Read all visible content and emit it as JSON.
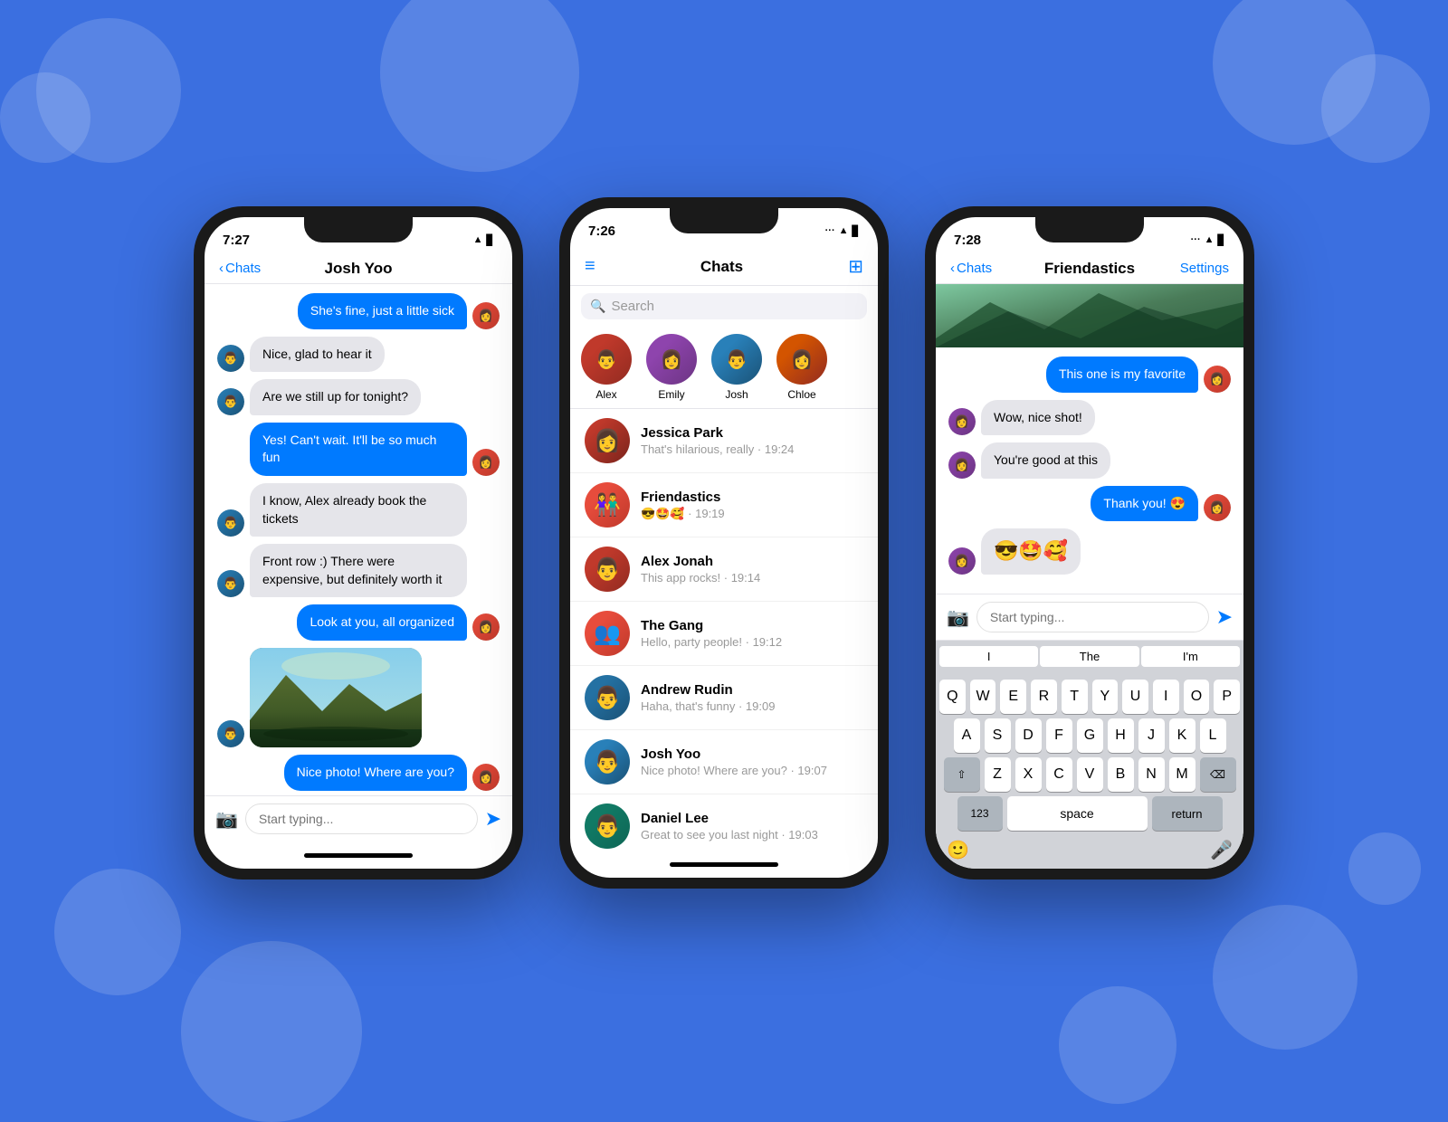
{
  "background": "#3B6FE0",
  "phone1": {
    "time": "7:27",
    "back_label": "Chats",
    "contact_name": "Josh Yoo",
    "messages": [
      {
        "id": 1,
        "type": "sent",
        "text": "She's fine, just a little sick",
        "has_avatar": true
      },
      {
        "id": 2,
        "type": "received",
        "text": "Nice, glad to hear it",
        "has_avatar": true
      },
      {
        "id": 3,
        "type": "received",
        "text": "Are we still up for tonight?",
        "has_avatar": true
      },
      {
        "id": 4,
        "type": "sent",
        "text": "Yes! Can't wait. It'll be so much fun",
        "has_avatar": true
      },
      {
        "id": 5,
        "type": "received",
        "text": "I know, Alex already book the tickets",
        "has_avatar": true
      },
      {
        "id": 6,
        "type": "received",
        "text": "Front row :) There were expensive, but definitely worth it",
        "has_avatar": true
      },
      {
        "id": 7,
        "type": "sent",
        "text": "Look at you, all organized",
        "has_avatar": true
      },
      {
        "id": 8,
        "type": "received",
        "text": "image",
        "is_image": true,
        "has_avatar": true
      },
      {
        "id": 9,
        "type": "sent",
        "text": "Nice photo! Where are you?",
        "has_avatar": true
      }
    ],
    "input_placeholder": "Start typing..."
  },
  "phone2": {
    "time": "7:26",
    "title": "Chats",
    "search_placeholder": "Search",
    "active_users": [
      {
        "name": "Alex",
        "avatar": "alex"
      },
      {
        "name": "Emily",
        "avatar": "emily"
      },
      {
        "name": "Josh",
        "avatar": "josh"
      },
      {
        "name": "Chloe",
        "avatar": "chloe"
      }
    ],
    "chats": [
      {
        "name": "Jessica Park",
        "preview": "That's hilarious, really · 19:24",
        "avatar": "jessica"
      },
      {
        "name": "Friendastics",
        "preview": "😎🤩🥰 · 19:19",
        "avatar": "gang"
      },
      {
        "name": "Alex Jonah",
        "preview": "This app rocks! · 19:14",
        "avatar": "alex"
      },
      {
        "name": "The Gang",
        "preview": "Hello, party people! · 19:12",
        "avatar": "gang"
      },
      {
        "name": "Andrew Rudin",
        "preview": "Haha, that's funny · 19:09",
        "avatar": "andrew"
      },
      {
        "name": "Josh Yoo",
        "preview": "Nice photo! Where are you? · 19:07",
        "avatar": "josh"
      },
      {
        "name": "Daniel Lee",
        "preview": "Great to see you last night · 19:03",
        "avatar": "daniel"
      }
    ]
  },
  "phone3": {
    "time": "7:28",
    "back_label": "Chats",
    "group_name": "Friendastics",
    "settings_label": "Settings",
    "messages": [
      {
        "id": 1,
        "type": "sent",
        "text": "This one is my favorite",
        "has_avatar": true
      },
      {
        "id": 2,
        "type": "received",
        "text": "Wow, nice shot!",
        "has_avatar": true
      },
      {
        "id": 3,
        "type": "received",
        "text": "You're good at this",
        "has_avatar": true
      },
      {
        "id": 4,
        "type": "sent",
        "text": "Thank you! 😍",
        "has_avatar": true
      },
      {
        "id": 5,
        "type": "received",
        "text": "😎🤩🥰",
        "has_avatar": true
      }
    ],
    "input_placeholder": "Start typing...",
    "keyboard": {
      "suggestions": [
        "I",
        "The",
        "I'm"
      ],
      "rows": [
        [
          "Q",
          "W",
          "E",
          "R",
          "T",
          "Y",
          "U",
          "I",
          "O",
          "P"
        ],
        [
          "A",
          "S",
          "D",
          "F",
          "G",
          "H",
          "J",
          "K",
          "L"
        ],
        [
          "⇧",
          "Z",
          "X",
          "C",
          "V",
          "B",
          "N",
          "M",
          "⌫"
        ],
        [
          "123",
          "space",
          "return"
        ]
      ]
    }
  }
}
